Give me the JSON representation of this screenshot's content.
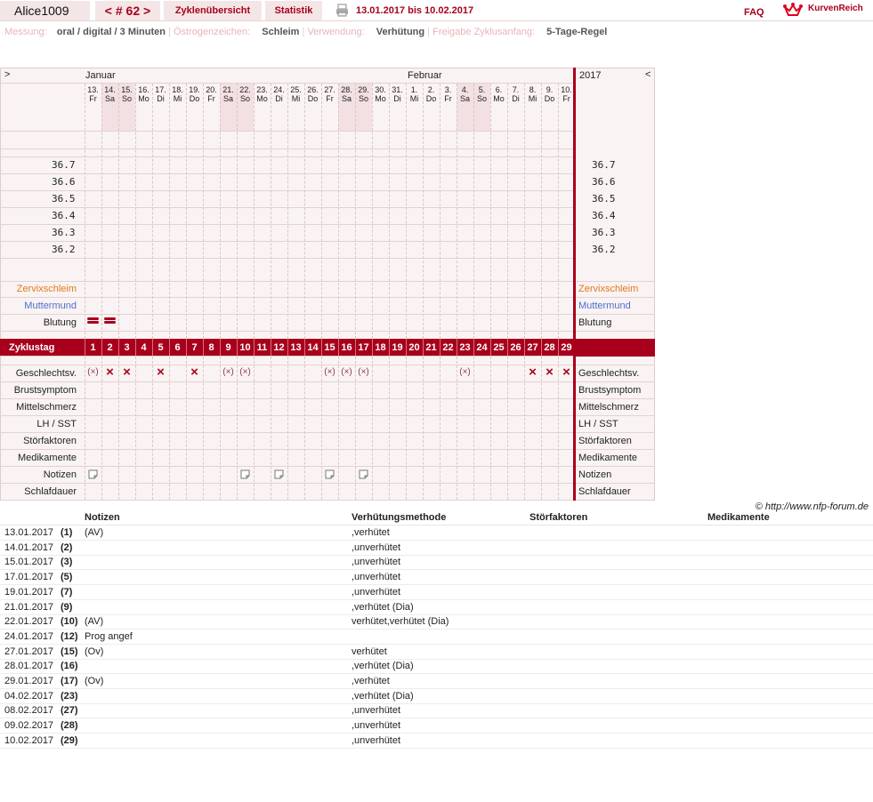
{
  "header": {
    "user": "Alice1009",
    "cycle": "< # 62 >",
    "tab_overview": "Zyklenübersicht",
    "tab_stats": "Statistik",
    "date_range": "13.01.2017 bis 10.02.2017",
    "faq": "FAQ",
    "brand": "KurvenReich"
  },
  "info": {
    "messung_label": "Messung:",
    "messung_value": "oral / digital / 3 Minuten",
    "oestro_label": "Östrogenzeichen:",
    "oestro_value": "Schleim",
    "verwendung_label": "Verwendung:",
    "verwendung_value": "Verhütung",
    "freigabe_label": "Freigabe Zyklusanfang:",
    "freigabe_value": "5-Tage-Regel"
  },
  "chart": {
    "nav_left": ">",
    "nav_right": "<",
    "month1": "Januar",
    "month2": "Februar",
    "year": "2017",
    "days": [
      [
        "13.",
        "Fr"
      ],
      [
        "14.",
        "Sa"
      ],
      [
        "15.",
        "So"
      ],
      [
        "16.",
        "Mo"
      ],
      [
        "17.",
        "Di"
      ],
      [
        "18.",
        "Mi"
      ],
      [
        "19.",
        "Do"
      ],
      [
        "20.",
        "Fr"
      ],
      [
        "21.",
        "Sa"
      ],
      [
        "22.",
        "So"
      ],
      [
        "23.",
        "Mo"
      ],
      [
        "24.",
        "Di"
      ],
      [
        "25.",
        "Mi"
      ],
      [
        "26.",
        "Do"
      ],
      [
        "27.",
        "Fr"
      ],
      [
        "28.",
        "Sa"
      ],
      [
        "29.",
        "So"
      ],
      [
        "30.",
        "Mo"
      ],
      [
        "31.",
        "Di"
      ],
      [
        "1.",
        "Mi"
      ],
      [
        "2.",
        "Do"
      ],
      [
        "3.",
        "Fr"
      ],
      [
        "4.",
        "Sa"
      ],
      [
        "5.",
        "So"
      ],
      [
        "6.",
        "Mo"
      ],
      [
        "7.",
        "Di"
      ],
      [
        "8.",
        "Mi"
      ],
      [
        "9.",
        "Do"
      ],
      [
        "10.",
        "Fr"
      ]
    ],
    "weekend_idx": [
      1,
      2,
      8,
      9,
      15,
      16,
      22,
      23
    ],
    "temps": [
      "36.7",
      "36.6",
      "36.5",
      "36.4",
      "36.3",
      "36.2"
    ],
    "rows_top": [
      "Zervixschleim",
      "Muttermund",
      "Blutung"
    ],
    "zyklustag_label": "Zyklustag",
    "rows_bottom": [
      "Geschlechtsv.",
      "Brustsymptom",
      "Mittelschmerz",
      "LH / SST",
      "Störfaktoren",
      "Medikamente",
      "Notizen",
      "Schlafdauer"
    ],
    "blutung_days": [
      0,
      1
    ],
    "sex_protected": [
      0,
      8,
      9,
      14,
      15,
      16,
      22
    ],
    "sex_unprotected": [
      1,
      2,
      4,
      6,
      26,
      27,
      28
    ],
    "notes_days": [
      0,
      9,
      11,
      14,
      16
    ],
    "copyright": "© http://www.nfp-forum.de"
  },
  "table": {
    "headers": [
      "Notizen",
      "Verhütungsmethode",
      "Störfaktoren",
      "Medikamente"
    ],
    "rows": [
      {
        "date": "13.01.2017",
        "day": "(1)",
        "note": "(AV)",
        "method": ",verhütet"
      },
      {
        "date": "14.01.2017",
        "day": "(2)",
        "note": "",
        "method": ",unverhütet"
      },
      {
        "date": "15.01.2017",
        "day": "(3)",
        "note": "",
        "method": ",unverhütet"
      },
      {
        "date": "17.01.2017",
        "day": "(5)",
        "note": "",
        "method": ",unverhütet"
      },
      {
        "date": "19.01.2017",
        "day": "(7)",
        "note": "",
        "method": ",unverhütet"
      },
      {
        "date": "21.01.2017",
        "day": "(9)",
        "note": "",
        "method": ",verhütet (Dia)"
      },
      {
        "date": "22.01.2017",
        "day": "(10)",
        "note": "(AV)",
        "method": "verhütet,verhütet (Dia)"
      },
      {
        "date": "24.01.2017",
        "day": "(12)",
        "note": "Prog angef",
        "method": ""
      },
      {
        "date": "27.01.2017",
        "day": "(15)",
        "note": "(Ov)",
        "method": "verhütet"
      },
      {
        "date": "28.01.2017",
        "day": "(16)",
        "note": "",
        "method": ",verhütet (Dia)"
      },
      {
        "date": "29.01.2017",
        "day": "(17)",
        "note": "(Ov)",
        "method": ",verhütet"
      },
      {
        "date": "04.02.2017",
        "day": "(23)",
        "note": "",
        "method": ",verhütet (Dia)"
      },
      {
        "date": "08.02.2017",
        "day": "(27)",
        "note": "",
        "method": ",unverhütet"
      },
      {
        "date": "09.02.2017",
        "day": "(28)",
        "note": "",
        "method": ",unverhütet"
      },
      {
        "date": "10.02.2017",
        "day": "(29)",
        "note": "",
        "method": ",unverhütet"
      }
    ]
  },
  "colors": {
    "accent": "#a8001c",
    "zervix": "#e07a1a",
    "muttermund": "#4a6fd0"
  }
}
